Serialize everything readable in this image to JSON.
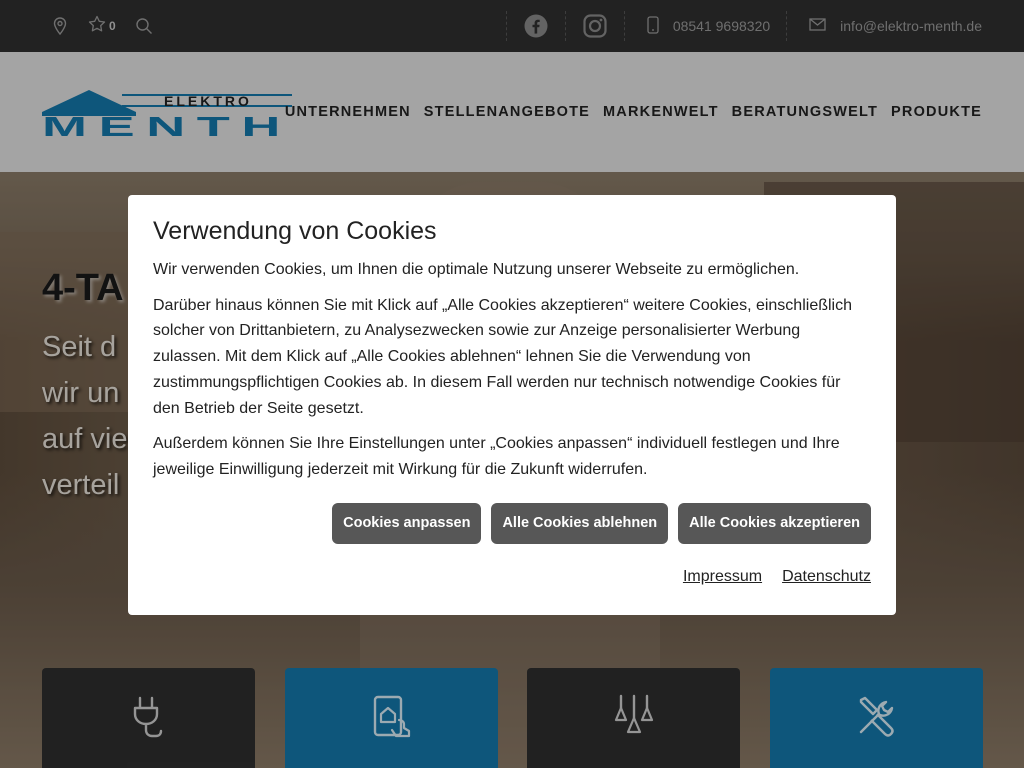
{
  "topbar": {
    "favorites_count": "0",
    "phone": "08541 9698320",
    "email": "info@elektro-menth.de",
    "icons": [
      "location-icon",
      "star-icon",
      "search-icon",
      "facebook-icon",
      "instagram-icon",
      "mobile-phone-icon",
      "mail-icon"
    ]
  },
  "header": {
    "logo_top": "ELEKTRO",
    "logo_bottom": "MENTH",
    "nav": [
      "UNTERNEHMEN",
      "STELLENANGEBOTE",
      "MARKENWELT",
      "BERATUNGSWELT",
      "PRODUKTE"
    ],
    "brand_color": "#1478ab"
  },
  "hero": {
    "title_visible": "4-TA",
    "lines_visible": [
      "Seit d",
      "wir un",
      "auf vie",
      "verteil"
    ]
  },
  "tiles": [
    {
      "icon": "plug-icon",
      "color": "#2f2f2f"
    },
    {
      "icon": "smart-home-tablet-icon",
      "color": "#1478ab"
    },
    {
      "icon": "lamps-icon",
      "color": "#2f2f2f"
    },
    {
      "icon": "tools-icon",
      "color": "#1478ab"
    }
  ],
  "cookie_dialog": {
    "title": "Verwendung von Cookies",
    "p1": "Wir verwenden Cookies, um Ihnen die optimale Nutzung unserer Webseite zu ermöglichen.",
    "p2": "Darüber hinaus können Sie mit Klick auf „Alle Cookies akzeptieren“ weitere Cookies, einschließlich solcher von Drittanbietern, zu Analysezwecken sowie zur Anzeige personalisierter Werbung zulassen. Mit dem Klick auf „Alle Cookies ablehnen“ lehnen Sie die Verwendung von zustimmungspflichtigen Cookies ab. In diesem Fall werden nur technisch notwendige Cookies für den Betrieb der Seite gesetzt.",
    "p3": "Außerdem können Sie Ihre Einstellungen unter „Cookies anpassen“ individuell festlegen und Ihre jeweilige Einwilligung jederzeit mit Wirkung für die Zukunft widerrufen.",
    "btn_customize": "Cookies anpassen",
    "btn_reject": "Alle Cookies ablehnen",
    "btn_accept": "Alle Cookies akzeptieren",
    "link_imprint": "Impressum",
    "link_privacy": "Datenschutz"
  }
}
